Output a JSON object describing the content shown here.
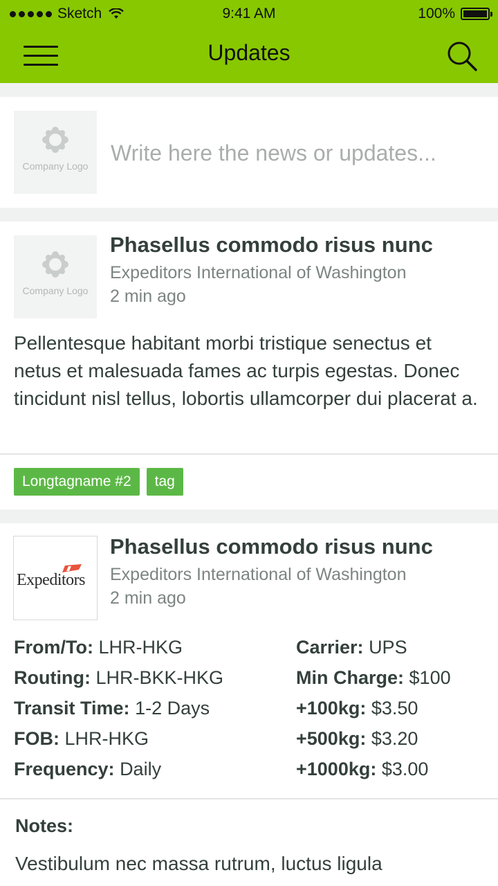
{
  "status_bar": {
    "carrier": "Sketch",
    "time": "9:41 AM",
    "battery": "100%"
  },
  "nav": {
    "title": "Updates",
    "menu_icon": "hamburger-menu-icon",
    "search_icon": "search-icon",
    "bar_color": "#88c800"
  },
  "composer": {
    "placeholder": "Write here the news or updates...",
    "logo_text": "Company Logo"
  },
  "posts": [
    {
      "title": "Phasellus commodo risus nunc",
      "company": "Expeditors International of Washington",
      "time": "2 min ago",
      "logo_text": "Company Logo",
      "body": "Pellentesque habitant morbi tristique senectus et netus et malesuada fames ac turpis egestas. Donec tincidunt nisl tellus, lobortis ullamcorper dui placerat a.",
      "tags": [
        "Longtagname #2",
        "tag"
      ]
    },
    {
      "title": "Phasellus commodo risus nunc",
      "company": "Expeditors International of Washington",
      "time": "2 min ago",
      "logo_text": "Expeditors",
      "specs_left": [
        {
          "label": "From/To:",
          "value": "LHR-HKG"
        },
        {
          "label": "Routing:",
          "value": "LHR-BKK-HKG"
        },
        {
          "label": "Transit Time:",
          "value": "1-2 Days"
        },
        {
          "label": "FOB:",
          "value": "LHR-HKG"
        },
        {
          "label": "Frequency:",
          "value": "Daily"
        }
      ],
      "specs_right": [
        {
          "label": "Carrier:",
          "value": "UPS"
        },
        {
          "label": "Min Charge:",
          "value": "$100"
        },
        {
          "label": "+100kg:",
          "value": "$3.50"
        },
        {
          "label": "+500kg:",
          "value": "$3.20"
        },
        {
          "label": "+1000kg:",
          "value": "$3.00"
        }
      ],
      "notes_title": "Notes:",
      "notes_body": "Vestibulum nec massa rutrum, luctus ligula"
    }
  ],
  "colors": {
    "tag": "#5cb846",
    "text": "#34403b",
    "muted": "#7c8581",
    "logo_accent": "#e8533c"
  }
}
